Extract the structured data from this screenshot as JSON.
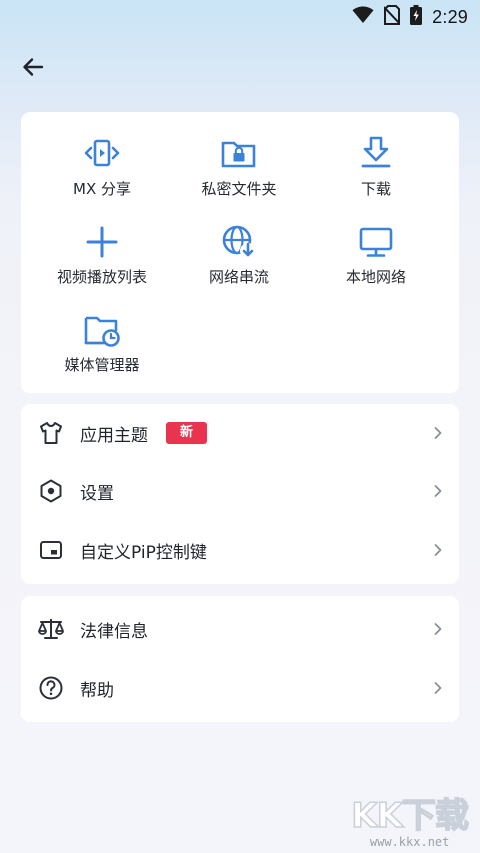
{
  "status_bar": {
    "time": "2:29"
  },
  "colors": {
    "accent": "#3b82d8",
    "badge": "#e8344e",
    "text": "#1f232c"
  },
  "grid": {
    "items": [
      {
        "label": "MX 分享",
        "icon": "share-transfer-icon"
      },
      {
        "label": "私密文件夹",
        "icon": "private-folder-lock-icon"
      },
      {
        "label": "下载",
        "icon": "download-icon"
      },
      {
        "label": "视频播放列表",
        "icon": "add-playlist-icon"
      },
      {
        "label": "网络串流",
        "icon": "network-stream-globe-icon"
      },
      {
        "label": "本地网络",
        "icon": "local-network-monitor-icon"
      },
      {
        "label": "媒体管理器",
        "icon": "media-manager-folder-icon"
      }
    ]
  },
  "settings_list": {
    "items": [
      {
        "label": "应用主题",
        "badge": "新",
        "icon": "tshirt-theme-icon"
      },
      {
        "label": "设置",
        "icon": "settings-hexagon-icon"
      },
      {
        "label": "自定义PiP控制键",
        "icon": "pip-icon"
      }
    ]
  },
  "info_list": {
    "items": [
      {
        "label": "法律信息",
        "icon": "scale-legal-icon"
      },
      {
        "label": "帮助",
        "icon": "help-question-icon"
      }
    ]
  },
  "watermark": {
    "logo": "KK下载",
    "url": "www.kkx.net"
  }
}
